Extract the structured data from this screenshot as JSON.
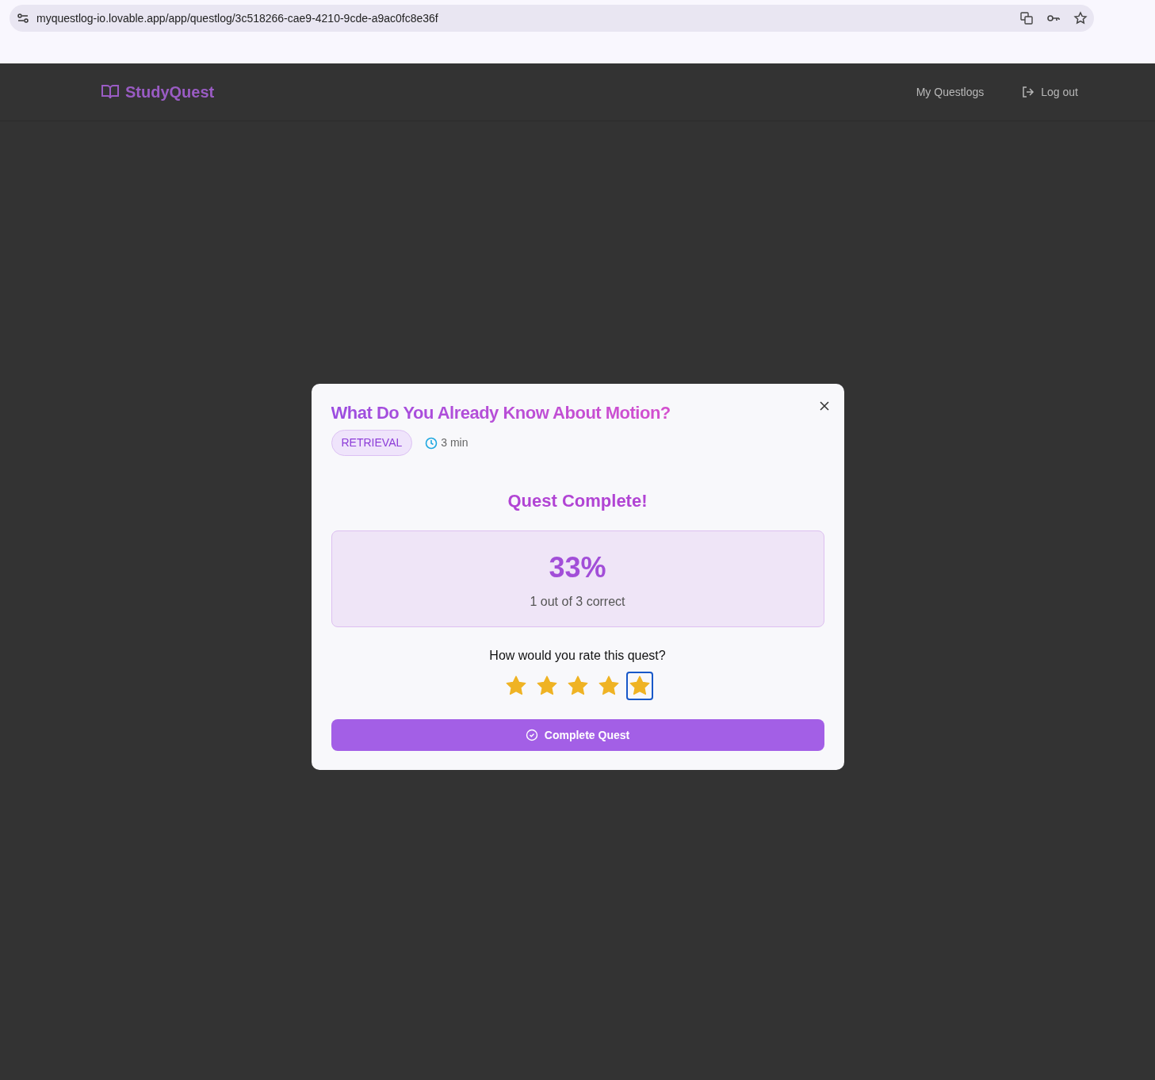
{
  "browser": {
    "url": "myquestlog-io.lovable.app/app/questlog/3c518266-cae9-4210-9cde-a9ac0fc8e36f"
  },
  "nav": {
    "brand": "StudyQuest",
    "links": [
      {
        "label": "My Questlogs",
        "kind": "plain"
      },
      {
        "label": "Log out",
        "kind": "logout"
      }
    ]
  },
  "dialog": {
    "title": "What Do You Already Know About Motion?",
    "tag": "RETRIEVAL",
    "duration": "3 min",
    "heading": "Quest Complete!",
    "score": {
      "percent": "33%",
      "caption": "1 out of 3 correct"
    },
    "rating": {
      "prompt": "How would you rate this quest?",
      "stars": 5,
      "focus_ring": true
    },
    "button": "Complete Quest"
  }
}
